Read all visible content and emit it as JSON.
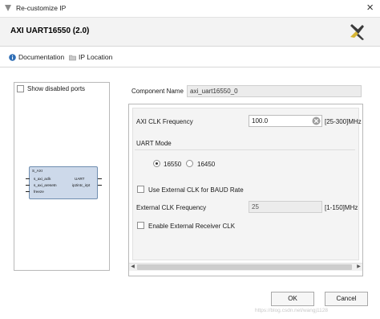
{
  "window": {
    "title": "Re-customize IP",
    "app_icon": "vivado-app-icon",
    "close_icon": "close-icon"
  },
  "header": {
    "ip_title": "AXI UART16550 (2.0)",
    "logo": "xilinx-logo"
  },
  "tabs": [
    {
      "label": "Documentation",
      "icon": "info-icon"
    },
    {
      "label": "IP Location",
      "icon": "folder-icon"
    }
  ],
  "left_panel": {
    "show_disabled_ports": {
      "label": "Show disabled ports",
      "checked": false
    },
    "symbol": {
      "left_ports": [
        "S_AXI",
        "s_axi_aclk",
        "s_axi_aresetn",
        "freeze"
      ],
      "right_ports": [
        "UART",
        "ip2intc_irpt"
      ]
    }
  },
  "component": {
    "label": "Component Name",
    "value": "axi_uart16550_0"
  },
  "settings": {
    "axi_clk": {
      "label": "AXI CLK Frequency",
      "value": "100.0",
      "range": "[25-300]MHz"
    },
    "uart_mode": {
      "label": "UART Mode",
      "options": [
        "16550",
        "16450"
      ],
      "selected": "16550"
    },
    "use_ext_clk": {
      "label": "Use External CLK for BAUD Rate",
      "checked": false
    },
    "ext_clk": {
      "label": "External CLK Frequency",
      "value": "25",
      "range": "[1-150]MHz"
    },
    "ext_rcv_clk": {
      "label": "Enable External Receiver CLK",
      "checked": false
    }
  },
  "buttons": {
    "ok": "OK",
    "cancel": "Cancel"
  },
  "watermark": "https://blog.csdn.net/wangj1128"
}
